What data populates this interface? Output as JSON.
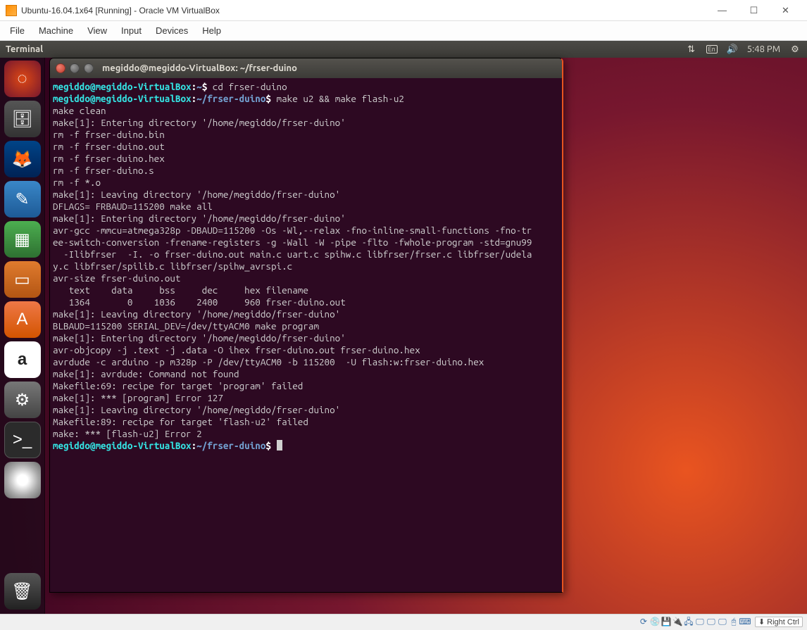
{
  "vbox": {
    "title": "Ubuntu-16.04.1x64 [Running] - Oracle VM VirtualBox",
    "menu": [
      "File",
      "Machine",
      "View",
      "Input",
      "Devices",
      "Help"
    ],
    "hostkey": "Right Ctrl"
  },
  "ubuntu_topbar": {
    "app": "Terminal",
    "lang": "En",
    "time": "5:48 PM"
  },
  "launcher": [
    {
      "name": "dash-icon",
      "cls": "ubuntu-logo",
      "glyph": "◌"
    },
    {
      "name": "files-icon",
      "cls": "files",
      "glyph": "🗄"
    },
    {
      "name": "firefox-icon",
      "cls": "firefox",
      "glyph": "🦊"
    },
    {
      "name": "writer-icon",
      "cls": "writer",
      "glyph": "✎"
    },
    {
      "name": "calc-icon",
      "cls": "calc",
      "glyph": "▦"
    },
    {
      "name": "impress-icon",
      "cls": "impress",
      "glyph": "▭"
    },
    {
      "name": "software-icon",
      "cls": "software",
      "glyph": "A"
    },
    {
      "name": "amazon-icon",
      "cls": "amazon",
      "glyph": "a"
    },
    {
      "name": "settings-icon",
      "cls": "settings",
      "glyph": "⚙"
    },
    {
      "name": "terminal-icon",
      "cls": "terminal",
      "glyph": ">_"
    },
    {
      "name": "disc-icon",
      "cls": "disc",
      "glyph": ""
    }
  ],
  "trash": {
    "name": "trash-icon",
    "cls": "trash",
    "glyph": "🗑"
  },
  "terminal": {
    "title": "megiddo@megiddo-VirtualBox: ~/frser-duino",
    "prompt1_user": "megiddo@megiddo-VirtualBox",
    "prompt1_path": "~",
    "prompt1_cmd": "cd frser-duino",
    "prompt2_user": "megiddo@megiddo-VirtualBox",
    "prompt2_path": "~/frser-duino",
    "prompt2_cmd": "make u2 && make flash-u2",
    "output": [
      "make clean",
      "make[1]: Entering directory '/home/megiddo/frser-duino'",
      "rm -f frser-duino.bin",
      "rm -f frser-duino.out",
      "rm -f frser-duino.hex",
      "rm -f frser-duino.s",
      "rm -f *.o",
      "make[1]: Leaving directory '/home/megiddo/frser-duino'",
      "DFLAGS= FRBAUD=115200 make all",
      "make[1]: Entering directory '/home/megiddo/frser-duino'",
      "avr-gcc -mmcu=atmega328p -DBAUD=115200 -Os -Wl,--relax -fno-inline-small-functions -fno-tree-switch-conversion -frename-registers -g -Wall -W -pipe -flto -fwhole-program -std=gnu99  -Ilibfrser  -I. -o frser-duino.out main.c uart.c spihw.c libfrser/frser.c libfrser/udelay.c libfrser/spilib.c libfrser/spihw_avrspi.c",
      "avr-size frser-duino.out",
      "   text    data     bss     dec     hex filename",
      "   1364       0    1036    2400     960 frser-duino.out",
      "make[1]: Leaving directory '/home/megiddo/frser-duino'",
      "BLBAUD=115200 SERIAL_DEV=/dev/ttyACM0 make program",
      "make[1]: Entering directory '/home/megiddo/frser-duino'",
      "avr-objcopy -j .text -j .data -O ihex frser-duino.out frser-duino.hex",
      "avrdude -c arduino -p m328p -P /dev/ttyACM0 -b 115200  -U flash:w:frser-duino.hex",
      "make[1]: avrdude: Command not found",
      "Makefile:69: recipe for target 'program' failed",
      "make[1]: *** [program] Error 127",
      "make[1]: Leaving directory '/home/megiddo/frser-duino'",
      "Makefile:89: recipe for target 'flash-u2' failed",
      "make: *** [flash-u2] Error 2"
    ],
    "prompt3_user": "megiddo@megiddo-VirtualBox",
    "prompt3_path": "~/frser-duino"
  },
  "status_icons": [
    "⟳",
    "💿",
    "💾",
    "🔌",
    "🖧",
    "🖵",
    "🖵",
    "🖵",
    "🖰",
    "⌨"
  ]
}
